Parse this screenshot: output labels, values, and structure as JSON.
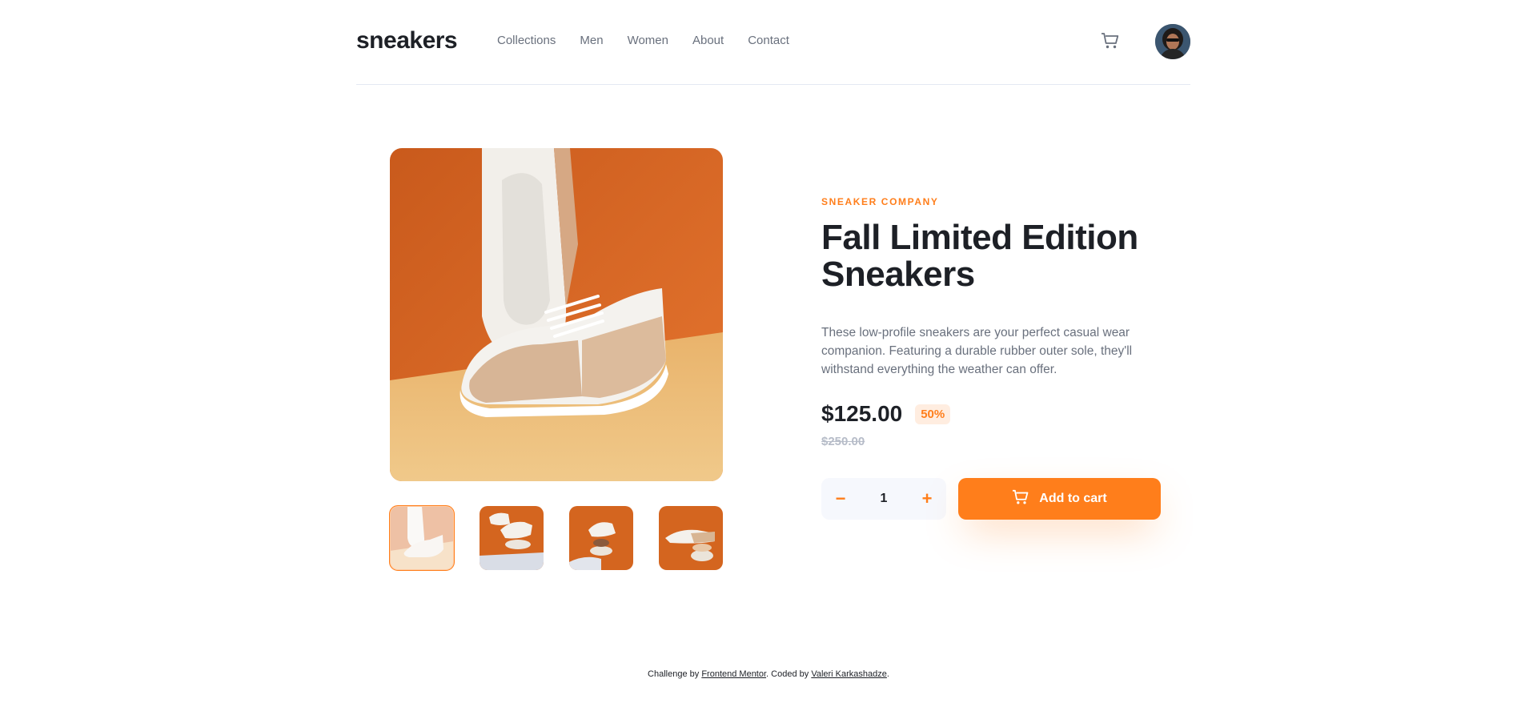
{
  "header": {
    "logo": "sneakers",
    "nav": [
      "Collections",
      "Men",
      "Women",
      "About",
      "Contact"
    ],
    "cart_icon": "cart-icon",
    "avatar_icon": "avatar"
  },
  "product": {
    "company": "SNEAKER COMPANY",
    "title": "Fall Limited Edition Sneakers",
    "description": "These low-profile sneakers are your perfect casual wear companion. Featuring a durable rubber outer sole, they'll withstand everything the weather can offer.",
    "price": "$125.00",
    "discount": "50%",
    "old_price": "$250.00",
    "quantity": "1",
    "minus": "−",
    "plus": "+",
    "add_to_cart": "Add to cart"
  },
  "footer": {
    "prefix": "Challenge by ",
    "challenge_link": "Frontend Mentor",
    "middle": ". Coded by ",
    "author_link": "Valeri Karkashadze",
    "suffix": "."
  },
  "colors": {
    "accent": "#ff7e1b",
    "accent_pale": "#ffede0",
    "dark": "#1d2026",
    "text_gray": "#69707d",
    "light_gray": "#b6bcc8",
    "qty_bg": "#f6f8fd"
  }
}
